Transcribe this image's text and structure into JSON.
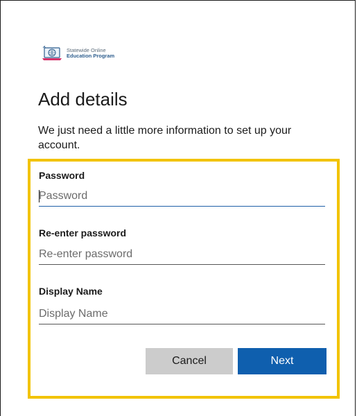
{
  "branding": {
    "logo_line1": "Statewide Online",
    "logo_line2": "Education Program"
  },
  "page": {
    "title": "Add details",
    "description": "We just need a little more information to set up your account."
  },
  "form": {
    "password": {
      "label": "Password",
      "placeholder": "Password",
      "value": ""
    },
    "reenter_password": {
      "label": "Re-enter password",
      "placeholder": "Re-enter password",
      "value": ""
    },
    "display_name": {
      "label": "Display Name",
      "placeholder": "Display Name",
      "value": ""
    }
  },
  "buttons": {
    "cancel_label": "Cancel",
    "next_label": "Next"
  },
  "colors": {
    "highlight": "#f2c300",
    "primary": "#0f5fae",
    "secondary_button": "#cccccc"
  }
}
